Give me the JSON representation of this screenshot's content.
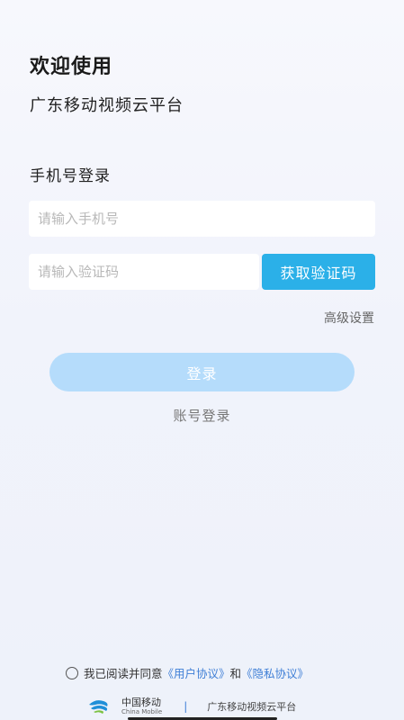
{
  "header": {
    "welcome": "欢迎使用",
    "platform": "广东移动视频云平台"
  },
  "login": {
    "section_title": "手机号登录",
    "phone_placeholder": "请输入手机号",
    "code_placeholder": "请输入验证码",
    "get_code_label": "获取验证码",
    "advanced_label": "高级设置",
    "login_label": "登录",
    "account_login_label": "账号登录"
  },
  "agreement": {
    "prefix": "我已阅读并同意",
    "user_agreement": "《用户协议》",
    "conjunction": "和",
    "privacy_policy": "《隐私协议》"
  },
  "footer": {
    "logo_cn": "中国移动",
    "logo_en": "China Mobile",
    "divider": "|",
    "platform": "广东移动视频云平台"
  },
  "colors": {
    "accent": "#2bb0e8",
    "login_button_disabled": "#b5dcfb",
    "link": "#3f7fd6"
  },
  "icons": {
    "brand_logo": "china-mobile-logo-icon",
    "agreement_checkbox": "radio-circle-icon"
  }
}
